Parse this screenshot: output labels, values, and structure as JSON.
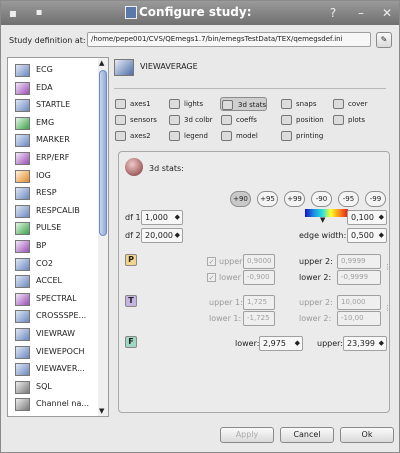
{
  "window": {
    "title": "Configure study:",
    "help_glyph": "?",
    "min_glyph": "–",
    "close_glyph": "✕",
    "menu_glyph": "▪"
  },
  "study": {
    "label": "Study definition at:",
    "path": "/home/pepe001/CVS/QEmegs1.7/bin/emegsTestData/TEX/qemegsdef.ini"
  },
  "left_list": {
    "items": [
      {
        "label": "ECG",
        "icon": "ecg-icon",
        "tone": "b"
      },
      {
        "label": "EDA",
        "icon": "eda-icon",
        "tone": "p"
      },
      {
        "label": "STARTLE",
        "icon": "startle-icon",
        "tone": "b"
      },
      {
        "label": "EMG",
        "icon": "emg-icon",
        "tone": "g"
      },
      {
        "label": "MARKER",
        "icon": "marker-icon",
        "tone": "b"
      },
      {
        "label": "ERP/ERF",
        "icon": "erp-icon",
        "tone": "p"
      },
      {
        "label": "IOG",
        "icon": "iog-icon",
        "tone": "o"
      },
      {
        "label": "RESP",
        "icon": "resp-icon",
        "tone": "b"
      },
      {
        "label": "RESPCALIB",
        "icon": "respcalib-icon",
        "tone": "b"
      },
      {
        "label": "PULSE",
        "icon": "pulse-icon",
        "tone": "g"
      },
      {
        "label": "BP",
        "icon": "bp-icon",
        "tone": "p"
      },
      {
        "label": "CO2",
        "icon": "co2-icon",
        "tone": "b"
      },
      {
        "label": "ACCEL",
        "icon": "accel-icon",
        "tone": "b"
      },
      {
        "label": "SPECTRAL",
        "icon": "spectral-icon",
        "tone": "p"
      },
      {
        "label": "CROSSSPE...",
        "icon": "crossspe-icon",
        "tone": "b"
      },
      {
        "label": "VIEWRAW",
        "icon": "viewraw-icon",
        "tone": "b"
      },
      {
        "label": "VIEWEPOCH",
        "icon": "viewepoch-icon",
        "tone": "b"
      },
      {
        "label": "VIEWAVER...",
        "icon": "viewaverage-icon",
        "tone": "b"
      },
      {
        "label": "SQL",
        "icon": "sql-icon",
        "tone": "k"
      },
      {
        "label": "Channel na...",
        "icon": "channel-icon",
        "tone": "k"
      }
    ]
  },
  "panel": {
    "title": "VIEWAVERAGE",
    "tools": [
      [
        "axes1",
        "lights",
        "3d stats",
        "snaps",
        "cover"
      ],
      [
        "sensors",
        "3d colbr",
        "coeffs",
        "position",
        "plots"
      ],
      [
        "axes2",
        "legend",
        "model",
        "printing"
      ]
    ],
    "stats_label": "3d stats:",
    "percentiles": [
      "+90",
      "+95",
      "+99",
      "-90",
      "-95",
      "-99"
    ],
    "df1_label": "df 1:",
    "df1_value": "1,000",
    "df2_label": "df 2:",
    "df2_value": "20,000",
    "pct_value": "0,100",
    "edge_label": "edge width:",
    "edge_value": "0,500",
    "p_block": {
      "upper_label": "upper",
      "upper_value": "0,9000",
      "upper2_label": "upper 2:",
      "upper2_value": "0,9999",
      "lower_label": "lower",
      "lower_value": "-0,900",
      "lower2_label": "lower 2:",
      "lower2_value": "-0,9999"
    },
    "t_block": {
      "upper1_label": "upper 1:",
      "upper1_value": "1,725",
      "upper2_label": "upper 2:",
      "upper2_value": "10,000",
      "lower1_label": "lower 1:",
      "lower1_value": "-1,725",
      "lower2_label": "lower 2:",
      "lower2_value": "-10,00"
    },
    "f_block": {
      "lower_label": "lower:",
      "lower_value": "2,975",
      "upper_label": "upper:",
      "upper_value": "23,399"
    },
    "p_letter": "P",
    "t_letter": "T",
    "f_letter": "F"
  },
  "footer": {
    "apply": "Apply",
    "cancel": "Cancel",
    "ok": "Ok"
  }
}
